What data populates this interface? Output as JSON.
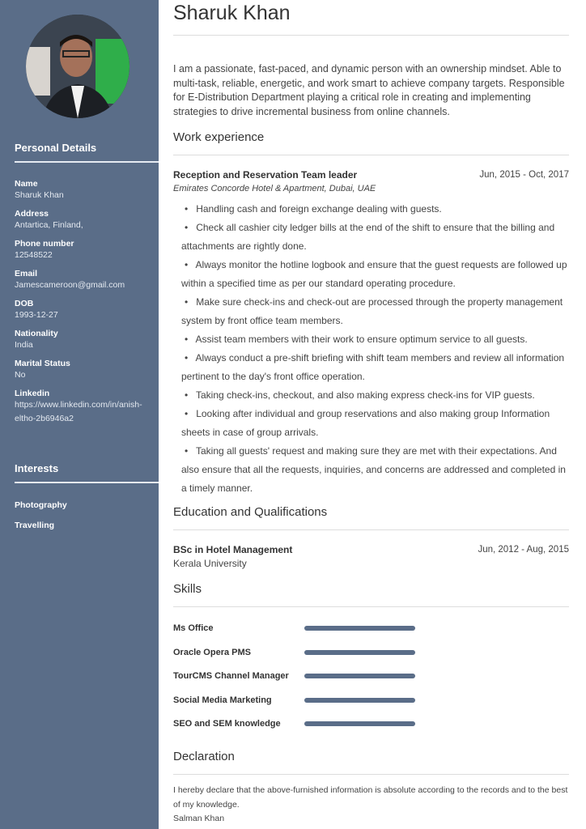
{
  "name": "Sharuk Khan",
  "sidebar": {
    "personal_title": "Personal Details",
    "details": [
      {
        "label": "Name",
        "value": "Sharuk Khan"
      },
      {
        "label": "Address",
        "value": "Antartica, Finland,"
      },
      {
        "label": "Phone number",
        "value": "12548522"
      },
      {
        "label": "Email",
        "value": "Jamescameroon@gmail.com"
      },
      {
        "label": "DOB",
        "value": "1993-12-27"
      },
      {
        "label": "Nationality",
        "value": "India"
      },
      {
        "label": "Marital Status",
        "value": "No"
      },
      {
        "label": "Linkedin",
        "value": "https://www.linkedin.com/in/anish-eltho-2b6946a2"
      }
    ],
    "interests_title": "Interests",
    "interests": [
      "Photography",
      "Travelling"
    ]
  },
  "summary": "I am a passionate, fast-paced, and dynamic person with an ownership mindset. Able to multi-task, reliable, energetic, and work smart to achieve company targets. Responsible for E-Distribution Department playing a critical role in creating and implementing strategies to drive incremental business from online channels.",
  "work": {
    "title": "Work experience",
    "job": {
      "role": "Reception and Reservation Team leader",
      "dates": "Jun, 2015 - Oct, 2017",
      "company": "Emirates Concorde Hotel & Apartment, Dubai, UAE",
      "bullets": [
        "Handling cash and foreign exchange dealing with guests.",
        "Check all cashier city ledger bills at the end of the shift to ensure that the billing and attachments are rightly done.",
        "Always monitor the hotline logbook and ensure that the guest requests are followed up within a specified time as per our standard operating procedure.",
        "Make sure check-ins and check-out are processed through the property management system by front office team members.",
        "Assist team members with their work to ensure optimum service to all guests.",
        "Always conduct a pre-shift briefing with shift team members and review all information pertinent to the day's front office operation.",
        "Taking check-ins, checkout, and also making express check-ins for VIP guests.",
        "Looking after individual and group reservations and also making group Information sheets in case of group arrivals.",
        "Taking all guests' request and making sure they are met with their expectations. And also ensure that all the requests, inquiries, and concerns are addressed and completed in a timely manner."
      ]
    }
  },
  "education": {
    "title": "Education and Qualifications",
    "degree": "BSc in Hotel Management",
    "dates": "Jun, 2012 - Aug, 2015",
    "school": "Kerala University"
  },
  "skills": {
    "title": "Skills",
    "items": [
      {
        "name": "Ms Office",
        "level": 100
      },
      {
        "name": "Oracle Opera PMS",
        "level": 100
      },
      {
        "name": "TourCMS Channel Manager",
        "level": 100
      },
      {
        "name": "Social Media Marketing",
        "level": 100
      },
      {
        "name": "SEO and SEM knowledge",
        "level": 100
      }
    ]
  },
  "declaration": {
    "title": "Declaration",
    "text": "I hereby declare that the above-furnished information is absolute according to the records and to the best of my knowledge.",
    "signature": "Salman Khan"
  },
  "colors": {
    "sidebar": "#5a6d88",
    "skill_bar": "#5a6d88"
  }
}
